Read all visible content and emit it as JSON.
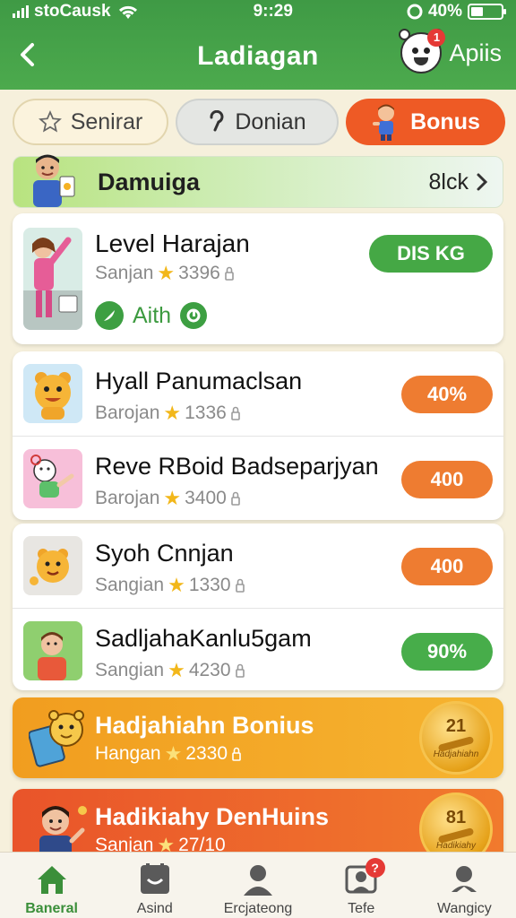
{
  "status_bar": {
    "carrier": "stoCausk",
    "time": "9::29",
    "battery": "40%",
    "battery_level": 0.4
  },
  "header": {
    "title": "Ladiagan",
    "right_label": "Apiis",
    "mascot_badge": "1"
  },
  "tabs": [
    {
      "label": "Senirar",
      "icon": "star-icon"
    },
    {
      "label": "Donian",
      "icon": "number-icon"
    },
    {
      "label": "Bonus",
      "icon": "character-icon"
    }
  ],
  "banner": {
    "title": "Damuiga",
    "action": "8lck"
  },
  "level_card": {
    "title": "Level Harajan",
    "sub_label": "Sanjan",
    "sub_value": "3396",
    "meta_label": "Aith",
    "pill": "DIS KG"
  },
  "list_items": [
    {
      "title": "Hyall Panumaclsan",
      "sub_label": "Barojan",
      "sub_value": "1336",
      "pill": "40%"
    },
    {
      "title": "Reve RBoid Badseparjyan",
      "sub_label": "Barojan",
      "sub_value": "3400",
      "pill": "400"
    },
    {
      "title": "Syoh Cnnjan",
      "sub_label": "Sangian",
      "sub_value": "1330",
      "pill": "400"
    },
    {
      "title": "SadljahaKanlu5gam",
      "sub_label": "Sangian",
      "sub_value": "4230",
      "pill": "90%"
    }
  ],
  "bonus_items": [
    {
      "title": "Hadjahiahn Bonius",
      "sub_label": "Hangan",
      "sub_value": "2330",
      "coin_number": "21",
      "coin_caption": "Hadjahiahn"
    },
    {
      "title": "Hadikiahy DenHuins",
      "sub_label": "Sanjan",
      "sub_value": "27/10",
      "coin_number": "81",
      "coin_caption": "Hadikiahy"
    }
  ],
  "bottom_nav": [
    {
      "label": "Baneral",
      "icon": "home-icon",
      "active": true
    },
    {
      "label": "Asind",
      "icon": "face-icon",
      "active": false
    },
    {
      "label": "Ercjateong",
      "icon": "person-icon",
      "active": false
    },
    {
      "label": "Tefe",
      "icon": "profile-icon",
      "active": false,
      "badge": "?"
    },
    {
      "label": "Wangicy",
      "icon": "user-icon",
      "active": false
    }
  ],
  "colors": {
    "header_green": "#4caa4d",
    "accent_orange": "#ee5a25",
    "pill_orange": "#ee7c31",
    "pill_green": "#47ad4a",
    "bonus_orange": "#f19d1f",
    "bonus_red": "#e9542a"
  }
}
